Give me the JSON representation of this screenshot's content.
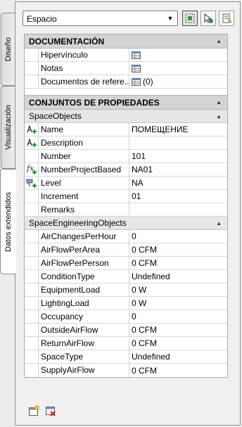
{
  "tabs": [
    {
      "label": "Diseño",
      "active": false
    },
    {
      "label": "Visualización",
      "active": false
    },
    {
      "label": "Datos extendidos",
      "active": true
    }
  ],
  "style_select": {
    "value": "Espacio"
  },
  "documentation": {
    "title": "DOCUMENTACIÓN",
    "rows": [
      {
        "name": "Hipervínculo",
        "value": ""
      },
      {
        "name": "Notas",
        "value": ""
      },
      {
        "name": "Documentos de refere...",
        "value": "(0)"
      }
    ]
  },
  "property_sets": {
    "title": "CONJUNTOS DE PROPIEDADES",
    "space_objects": {
      "title": "SpaceObjects",
      "rows": [
        {
          "name": "Name",
          "value": "ПОМЕЩЕНИЕ",
          "icon": "auto-property-icon"
        },
        {
          "name": "Description",
          "value": "",
          "icon": "auto-property-icon"
        },
        {
          "name": "Number",
          "value": "101",
          "icon": ""
        },
        {
          "name": "NumberProjectBased",
          "value": "NA01",
          "icon": "formula-property-icon"
        },
        {
          "name": "Level",
          "value": "NA",
          "icon": "location-property-icon"
        },
        {
          "name": "Increment",
          "value": "01",
          "icon": ""
        },
        {
          "name": "Remarks",
          "value": "",
          "icon": ""
        }
      ]
    },
    "space_engineering": {
      "title": "SpaceEngineeringObjects",
      "rows": [
        {
          "name": "AirChangesPerHour",
          "value": "0"
        },
        {
          "name": "AirFlowPerArea",
          "value": "0 CFM"
        },
        {
          "name": "AirFlowPerPerson",
          "value": "0 CFM"
        },
        {
          "name": "ConditionType",
          "value": "Undefined"
        },
        {
          "name": "EquipmentLoad",
          "value": "0 W"
        },
        {
          "name": "LightingLoad",
          "value": "0 W"
        },
        {
          "name": "Occupancy",
          "value": "0"
        },
        {
          "name": "OutsideAirFlow",
          "value": "0 CFM"
        },
        {
          "name": "ReturnAirFlow",
          "value": "0 CFM"
        },
        {
          "name": "SpaceType",
          "value": "Undefined"
        },
        {
          "name": "SupplyAirFlow",
          "value": "0 CFM"
        }
      ]
    }
  }
}
